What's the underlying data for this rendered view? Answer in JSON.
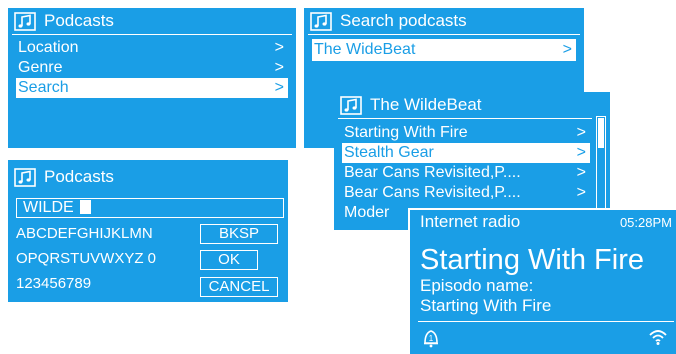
{
  "screen1": {
    "title": "Podcasts",
    "items": [
      {
        "label": "Location",
        "arrow": ">",
        "selected": false
      },
      {
        "label": "Genre",
        "arrow": ">",
        "selected": false
      },
      {
        "label": "Search",
        "arrow": ">",
        "selected": true
      }
    ]
  },
  "screen2": {
    "title": "Search podcasts",
    "items": [
      {
        "label": "The WideBeat",
        "arrow": ">",
        "selected": true
      }
    ]
  },
  "screen3": {
    "title": "The WildeBeat",
    "items": [
      {
        "label": "Starting With Fire",
        "arrow": ">",
        "selected": false
      },
      {
        "label": "Stealth Gear",
        "arrow": ">",
        "selected": true
      },
      {
        "label": "Bear Cans Revisited,P....",
        "arrow": ">",
        "selected": false
      },
      {
        "label": "Bear Cans Revisited,P....",
        "arrow": ">",
        "selected": false
      },
      {
        "label": "Moder",
        "arrow": "",
        "selected": false
      }
    ]
  },
  "screen4": {
    "title": "Podcasts",
    "input_value": "WILDE",
    "keyboard_rows": [
      "ABCDEFGHIJKLMN",
      "OPQRSTUVWXYZ 0",
      "123456789"
    ],
    "buttons": {
      "backspace": "BKSP",
      "ok": "OK",
      "cancel": "CANCEL"
    }
  },
  "screen5": {
    "source": "Internet radio",
    "time": "05:28PM",
    "title": "Starting With Fire",
    "line1": "Episodo name:",
    "line2": "Starting With Fire",
    "icons": [
      "alarm-1-icon",
      "wifi-signal-icon"
    ]
  },
  "colors": {
    "screen_bg": "#1a9ee6",
    "foreground": "#ffffff"
  }
}
